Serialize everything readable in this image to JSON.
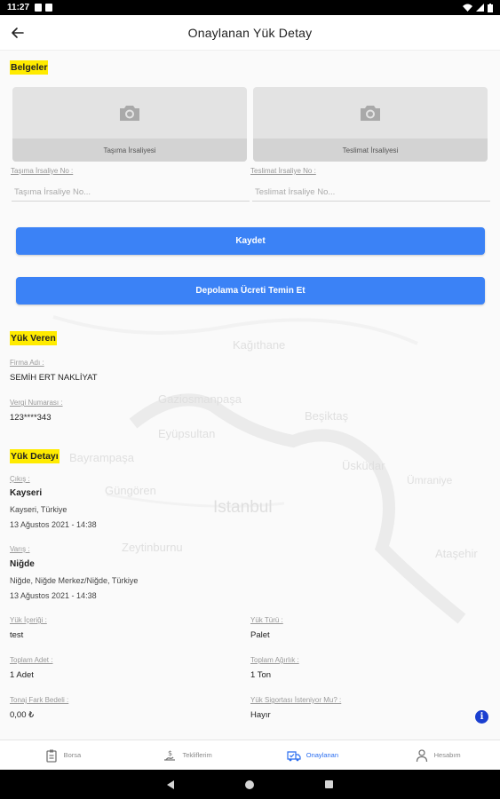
{
  "status_bar": {
    "time": "11:27"
  },
  "app_bar": {
    "title": "Onaylanan Yük Detay"
  },
  "documents": {
    "section_title": "Belgeler",
    "photo_left_caption": "Taşıma İrsaliyesi",
    "photo_right_caption": "Teslimat İrsaliyesi",
    "transport_label": "Taşıma İrsaliye No :",
    "transport_placeholder": "Taşıma İrsaliye No...",
    "delivery_label": "Teslimat İrsaliye No :",
    "delivery_placeholder": "Teslimat İrsaliye No..."
  },
  "buttons": {
    "save": "Kaydet",
    "storage_fee": "Depolama Ücreti Temin Et"
  },
  "shipper": {
    "section_title": "Yük Veren",
    "company_label": "Firma Adı :",
    "company_value": "SEMİH ERT NAKLİYAT",
    "tax_label": "Vergi Numarası :",
    "tax_value": "123****343"
  },
  "load": {
    "section_title": "Yük Detayı",
    "departure_label": "Çıkış :",
    "departure_city": "Kayseri",
    "departure_address": "Kayseri, Türkiye",
    "departure_date": "13 Ağustos 2021 - 14:38",
    "arrival_label": "Varış :",
    "arrival_city": "Niğde",
    "arrival_address": "Niğde, Niğde Merkez/Niğde, Türkiye",
    "arrival_date": "13 Ağustos 2021 - 14:38",
    "content_label": "Yük İçeriği :",
    "content_value": "test",
    "type_label": "Yük Türü :",
    "type_value": "Palet",
    "count_label": "Toplam Adet :",
    "count_value": "1 Adet",
    "weight_label": "Toplam Ağırlık :",
    "weight_value": "1 Ton",
    "tonnage_label": "Tonaj Fark Bedeli :",
    "tonnage_value": "0,00 ₺",
    "insurance_label": "Yük Sigortası İsteniyor Mu? :",
    "insurance_value": "Hayır"
  },
  "map_labels": [
    "Kağıthane",
    "Gaziosmanpaşa",
    "Beşiktaş",
    "Eyüpsultan",
    "Bayrampaşa",
    "Üsküdar",
    "Güngören",
    "Ümraniye",
    "Istanbul",
    "Zeytinburnu",
    "Ataşehir"
  ],
  "bottom_nav": {
    "items": [
      {
        "label": "Borsa",
        "icon": "clipboard-icon"
      },
      {
        "label": "Tekliflerim",
        "icon": "offers-icon"
      },
      {
        "label": "Onaylanan",
        "icon": "truck-check-icon"
      },
      {
        "label": "Hesabım",
        "icon": "person-icon"
      }
    ]
  },
  "colors": {
    "accent": "#3b82f6",
    "highlight": "#ffeb00",
    "nav_active": "#2b6ef0"
  }
}
